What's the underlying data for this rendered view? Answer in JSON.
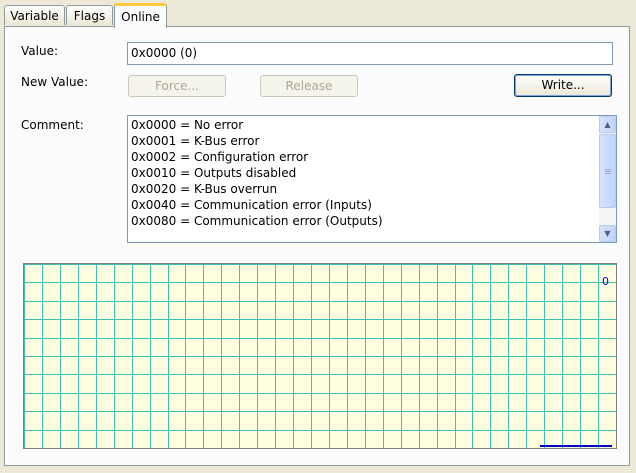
{
  "tabs": [
    {
      "label": "Variable"
    },
    {
      "label": "Flags"
    },
    {
      "label": "Online",
      "active": true
    }
  ],
  "online": {
    "value_label": "Value:",
    "value": "0x0000 (0)",
    "new_value_label": "New Value:",
    "force_label": "Force...",
    "release_label": "Release",
    "write_label": "Write...",
    "comment_label": "Comment:",
    "comment_lines": [
      "0x0000 = No error",
      "0x0001 = K-Bus error",
      "0x0002 = Configuration error",
      "0x0010 = Outputs disabled",
      "0x0020 = K-Bus overrun",
      "0x0040 = Communication error (Inputs)",
      "0x0080 = Communication error (Outputs)"
    ]
  },
  "chart_data": {
    "type": "line",
    "title": "",
    "xlabel": "",
    "ylabel": "",
    "y_readout": "0",
    "series": [
      {
        "values": [
          0,
          0
        ]
      }
    ],
    "grid": true,
    "colors": {
      "background": "#ffffe0",
      "grid": "#40c0b0",
      "line": "#0000c0",
      "readout": "#0000ff"
    }
  }
}
